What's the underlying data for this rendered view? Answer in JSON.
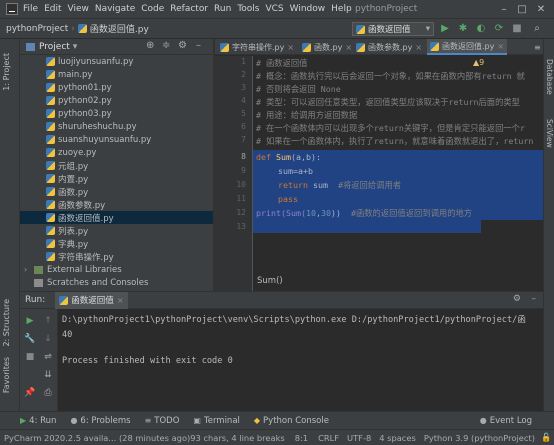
{
  "menu": [
    "File",
    "Edit",
    "View",
    "Navigate",
    "Code",
    "Refactor",
    "Run",
    "Tools",
    "VCS",
    "Window",
    "Help"
  ],
  "window_title": "pythonProject",
  "nav": {
    "project": "pythonProject",
    "file": "函数返回值.py",
    "run_config": "函数返回值"
  },
  "project_panel": {
    "title": "Project",
    "files": [
      "luojiyunsuanfu.py",
      "main.py",
      "python01.py",
      "python02.py",
      "python03.py",
      "shuruheshuchu.py",
      "suanshuyunsuanfu.py",
      "zuoye.py",
      "元组.py",
      "内置.py",
      "函数.py",
      "函数参数.py",
      "函数返回值.py",
      "列表.py",
      "字典.py",
      "字符串操作.py"
    ],
    "external_libraries": "External Libraries",
    "scratches": "Scratches and Consoles"
  },
  "tabs": [
    "字符串操作.py",
    "函数.py",
    "函数参数.py",
    "函数返回值.py"
  ],
  "editor": {
    "line_numbers": [
      "1",
      "2",
      "3",
      "4",
      "5",
      "6",
      "7",
      "8",
      "9",
      "10",
      "11",
      "12",
      "13"
    ],
    "warnings": "▲9",
    "lines": [
      "# 函数返回值",
      "# 概念：函数执行完以后会返回一个对象，如果在函数内部有return 就",
      "# 否则将会返回 None",
      "# 类型：可以返回任意类型，返回值类型应该取决于return后面的类型",
      "# 用途：给调用方返回数据",
      "# 在一个函数体内可以出现多个return关键字，但是肯定只能返回一个r",
      "# 如果在一个函数体内，执行了return，就意味着函数就退出了，return",
      "def Sum(a,b):",
      "sum=a+b",
      "return sum",
      "#将返回给调用者",
      "pass",
      "print(Sum(10,30))",
      "#函数的返回值返回到调用的地方"
    ],
    "def_kw": "def",
    "fn_name": "Sum",
    "params": "(a,b):",
    "return_kw": "return",
    "pass_kw": "pass",
    "print_call": "print(Sum(",
    "arg1": "10",
    "comma": ",",
    "arg2": "30",
    "close": "))",
    "breadcrumb": "Sum()"
  },
  "right_strip": [
    "Database",
    "SciView"
  ],
  "left_strip": [
    "1: Project",
    "2: Structure",
    "Favorites"
  ],
  "run_panel": {
    "label": "Run:",
    "tab": "函数返回值",
    "console": [
      "D:\\pythonProject1\\pythonProject\\venv\\Scripts\\python.exe D:/pythonProject1/pythonProject/函",
      "40",
      "",
      "Process finished with exit code 0"
    ]
  },
  "bottom_tabs": [
    "4: Run",
    "6: Problems",
    "TODO",
    "Terminal",
    "Python Console"
  ],
  "event_log": "Event Log",
  "status": {
    "left": "PyCharm 2020.2.5 availa... (28 minutes ago)",
    "chars": "93 chars, 4 line breaks",
    "pos": "8:1",
    "crlf": "CRLF",
    "enc": "UTF-8",
    "indent": "4 spaces",
    "interp": "Python 3.9 (pythonProject)"
  }
}
